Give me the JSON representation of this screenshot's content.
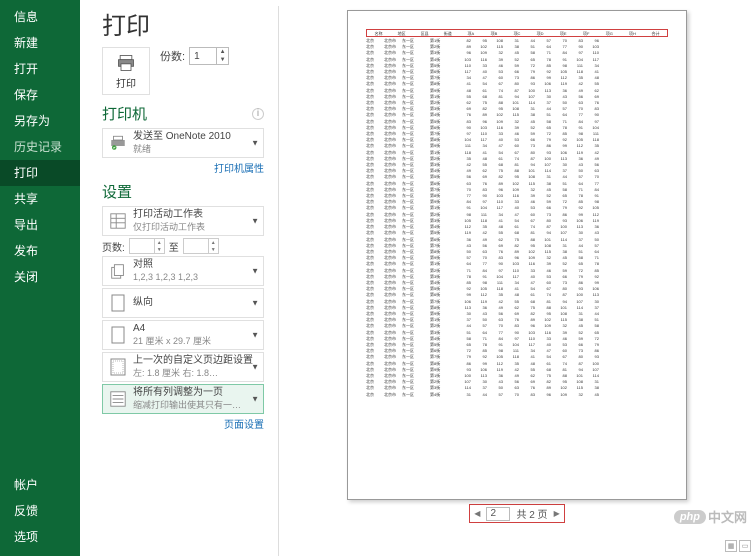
{
  "sidebar": {
    "items": [
      {
        "label": "信息"
      },
      {
        "label": "新建"
      },
      {
        "label": "打开"
      },
      {
        "label": "保存"
      },
      {
        "label": "另存为"
      },
      {
        "label": "历史记录",
        "dim": true
      },
      {
        "label": "打印",
        "active": true
      },
      {
        "label": "共享"
      },
      {
        "label": "导出"
      },
      {
        "label": "发布"
      },
      {
        "label": "关闭"
      }
    ],
    "bottom": [
      {
        "label": "帐户"
      },
      {
        "label": "反馈"
      },
      {
        "label": "选项"
      }
    ]
  },
  "title": "打印",
  "print_button": "打印",
  "copies": {
    "label": "份数:",
    "value": "1"
  },
  "printer": {
    "heading": "打印机",
    "name": "发送至 OneNote 2010",
    "status": "就绪",
    "props_link": "打印机属性"
  },
  "settings": {
    "heading": "设置",
    "sheet": {
      "line1": "打印活动工作表",
      "line2": "仅打印活动工作表"
    },
    "pages": {
      "label": "页数:",
      "to": "至"
    },
    "collate": {
      "line1": "对照",
      "line2": "1,2,3   1,2,3   1,2,3"
    },
    "orientation": "纵向",
    "paper": {
      "line1": "A4",
      "line2": "21 厘米 x 29.7 厘米"
    },
    "margins": {
      "line1": "上一次的自定义页边距设置",
      "line2": "左: 1.8 厘米  右: 1.8…"
    },
    "scaling": {
      "line1": "将所有列调整为一页",
      "line2": "缩减打印输出使其只有一…"
    },
    "page_setup_link": "页面设置"
  },
  "pager": {
    "current": "2",
    "total_text": "共 2 页"
  },
  "preview": {
    "headers": [
      "名称",
      "地区",
      "区县",
      "街道",
      "项A",
      "项B",
      "项C",
      "项D",
      "项E",
      "项F",
      "项G",
      "项H",
      "合计"
    ],
    "rows_count": 58
  },
  "watermark": {
    "php": "php",
    "text": "中文网"
  }
}
